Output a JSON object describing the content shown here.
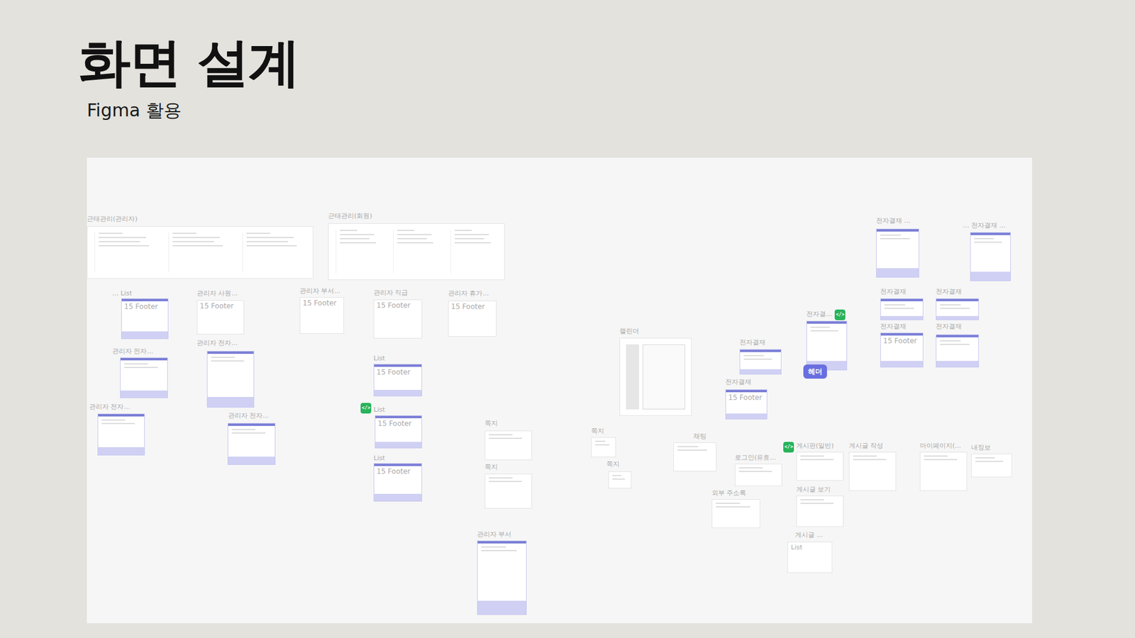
{
  "slide": {
    "title": "화면 설계",
    "subtitle": "Figma 활용"
  },
  "canvas": {
    "frames": [
      {
        "label": "근태관리(관리자)",
        "kind": "wide"
      },
      {
        "label": "근태관리(회원)",
        "kind": "wide"
      },
      {
        "label": "... List",
        "kind": "purple",
        "footer": "15 Footer"
      },
      {
        "label": "관리자 사원...",
        "kind": "plain",
        "footer": "15 Footer"
      },
      {
        "label": "관리자 부서...",
        "kind": "plain",
        "footer": "15 Footer"
      },
      {
        "label": "관리자 직급",
        "kind": "plain",
        "footer": "15 Footer"
      },
      {
        "label": "관리자 휴가...",
        "kind": "plain",
        "footer": "15 Footer"
      },
      {
        "label": "관리자 전자...",
        "kind": "purple"
      },
      {
        "label": "관리자 전자...",
        "kind": "purple"
      },
      {
        "label": "관리자 전자...",
        "kind": "purple"
      },
      {
        "label": "관리자 전자...",
        "kind": "purple"
      },
      {
        "label": "List",
        "kind": "purple",
        "footer": "15 Footer"
      },
      {
        "label": "List",
        "kind": "purple",
        "footer": "15 Footer"
      },
      {
        "label": "List",
        "kind": "purple",
        "footer": "15 Footer"
      },
      {
        "label": "쪽지",
        "kind": "plain"
      },
      {
        "label": "쪽지",
        "kind": "plain"
      },
      {
        "label": "캘린더",
        "kind": "calendar"
      },
      {
        "label": "전자결재",
        "kind": "purple"
      },
      {
        "label": "전자결재",
        "kind": "purple",
        "footer": "15 Footer"
      },
      {
        "label": "전자결...",
        "kind": "purple"
      },
      {
        "label": "전자결재 ...",
        "kind": "purple"
      },
      {
        "label": "... 전자결재 ...",
        "kind": "purple"
      },
      {
        "label": "전자결재",
        "kind": "purple"
      },
      {
        "label": "전자결재",
        "kind": "purple"
      },
      {
        "label": "전자결재",
        "kind": "purple",
        "footer": "15 Footer"
      },
      {
        "label": "전자결재",
        "kind": "purple"
      },
      {
        "label": "쪽지",
        "kind": "plain"
      },
      {
        "label": "쪽지",
        "kind": "plain"
      },
      {
        "label": "채팅",
        "kind": "plain"
      },
      {
        "label": "로그인(유효...",
        "kind": "plain"
      },
      {
        "label": "외부 주소록",
        "kind": "plain"
      },
      {
        "label": "게시판(일반)",
        "kind": "plain"
      },
      {
        "label": "게시글 작성",
        "kind": "plain"
      },
      {
        "label": "마이페이지(...",
        "kind": "plain"
      },
      {
        "label": "내정보",
        "kind": "plain"
      },
      {
        "label": "게시글 보기",
        "kind": "plain"
      },
      {
        "label": "게시글 ...",
        "kind": "plain",
        "tag": "List"
      },
      {
        "label": "관리자 부서",
        "kind": "purple"
      }
    ],
    "badges": [
      {
        "label": "</>",
        "kind": "code"
      },
      {
        "label": "</>",
        "kind": "code"
      },
      {
        "label": "</>",
        "kind": "code"
      },
      {
        "label": "헤더",
        "kind": "header"
      }
    ]
  }
}
